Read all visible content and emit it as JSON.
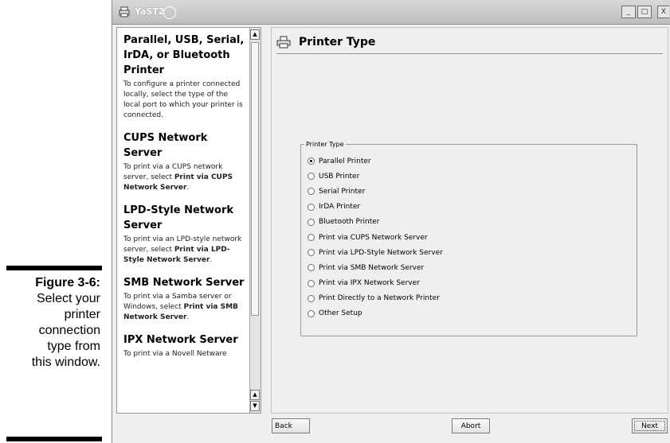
{
  "caption": {
    "label": "Figure 3-6:",
    "lines": [
      "Select your",
      "printer",
      "connection",
      "type from",
      "this window."
    ]
  },
  "window": {
    "title": "YaST2",
    "buttons": [
      "minimize",
      "maximize",
      "close"
    ]
  },
  "help": {
    "sections": [
      {
        "heading": "Parallel, USB, Serial, IrDA, or Bluetooth Printer",
        "text": "To configure a printer connected locally, select the type of the local port to which your printer is connected."
      },
      {
        "heading": "CUPS Network Server",
        "text_before": "To print via a CUPS network server, select ",
        "bold": "Print via CUPS Network Server",
        "text_after": "."
      },
      {
        "heading": "LPD-Style Network Server",
        "text_before": "To print via an LPD-style network server, select ",
        "bold": "Print via LPD-Style Network Server",
        "text_after": "."
      },
      {
        "heading": "SMB Network Server",
        "text_before": "To print via a Samba server or Windows, select ",
        "bold": "Print via SMB Network Server",
        "text_after": "."
      },
      {
        "heading": "IPX Network Server",
        "text_before": "To print via a Novell Netware",
        "bold": "",
        "text_after": ""
      }
    ]
  },
  "main": {
    "title": "Printer Type",
    "group_label": "Printer Type",
    "options": [
      {
        "label": "Parallel Printer",
        "selected": true
      },
      {
        "label": "USB Printer",
        "selected": false
      },
      {
        "label": "Serial Printer",
        "selected": false
      },
      {
        "label": "IrDA Printer",
        "selected": false
      },
      {
        "label": "Bluetooth Printer",
        "selected": false
      },
      {
        "label": "Print via CUPS Network Server",
        "selected": false
      },
      {
        "label": "Print via LPD-Style Network Server",
        "selected": false
      },
      {
        "label": "Print via SMB Network Server",
        "selected": false
      },
      {
        "label": "Print via IPX Network Server",
        "selected": false
      },
      {
        "label": "Print Directly to a Network Printer",
        "selected": false
      },
      {
        "label": "Other Setup",
        "selected": false
      }
    ]
  },
  "buttons": {
    "back": "Back",
    "abort": "Abort",
    "next": "Next"
  }
}
